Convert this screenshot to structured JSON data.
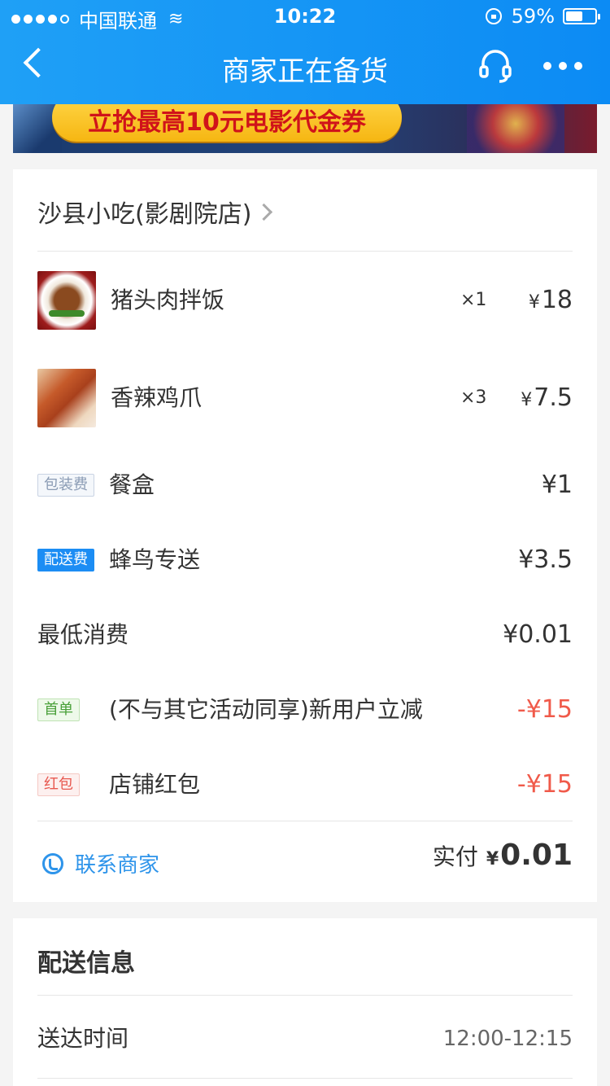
{
  "status_bar": {
    "carrier": "中国联通",
    "time": "10:22",
    "battery_percent": "59%",
    "battery_level": 0.59
  },
  "nav": {
    "title": "商家正在备货"
  },
  "banner": {
    "text": "立抢最高10元电影代金券"
  },
  "order": {
    "shop_name": "沙县小吃(影剧院店)",
    "items": [
      {
        "name": "猪头肉拌饭",
        "qty": "×1",
        "price": "18"
      },
      {
        "name": "香辣鸡爪",
        "qty": "×3",
        "price": "7.5"
      }
    ],
    "fees": [
      {
        "tag": "包装费",
        "name": "餐盒",
        "price": "¥1",
        "negative": false
      },
      {
        "tag": "配送费",
        "name": "蜂鸟专送",
        "price": "¥3.5",
        "negative": false
      },
      {
        "tag": "",
        "name": "最低消费",
        "price": "¥0.01",
        "negative": false
      },
      {
        "tag": "首单",
        "name": "(不与其它活动同享)新用户立减",
        "price": "-¥15",
        "negative": true
      },
      {
        "tag": "红包",
        "name": "店铺红包",
        "price": "-¥15",
        "negative": true
      }
    ],
    "contact_label": "联系商家",
    "total_label": "实付",
    "total_amount": "0.01",
    "currency": "¥"
  },
  "delivery": {
    "title": "配送信息",
    "arrival_label": "送达时间",
    "arrival_time": "12:00-12:15"
  },
  "colors": {
    "header_blue": "#0c8bf4",
    "link_blue": "#2e94ea",
    "discount_red": "#f05a4a"
  }
}
